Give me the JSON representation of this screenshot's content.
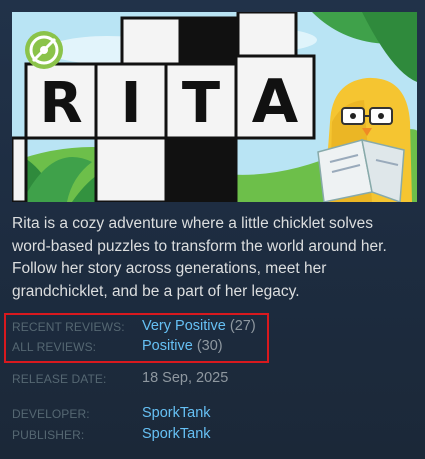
{
  "capsule": {
    "title_letters": [
      "R",
      "I",
      "T",
      "A"
    ]
  },
  "description": "Rita is a cozy adventure where a little chicklet solves word-based puzzles to transform the world around her. Follow her story across generations, meet her grandchicklet, and be a part of her legacy.",
  "reviews": {
    "recent": {
      "label": "RECENT REVIEWS:",
      "summary": "Very Positive",
      "count": "(27)"
    },
    "all": {
      "label": "ALL REVIEWS:",
      "summary": "Positive",
      "count": "(30)"
    }
  },
  "release": {
    "label": "RELEASE DATE:",
    "date": "18 Sep, 2025"
  },
  "developer": {
    "label": "DEVELOPER:",
    "name": "SporkTank"
  },
  "publisher": {
    "label": "PUBLISHER:",
    "name": "SporkTank"
  },
  "colors": {
    "background": "#1b2838",
    "link": "#66c0f4",
    "label": "#556772",
    "text": "#dcdedf",
    "muted": "#8f98a0",
    "highlight": "#d8191e"
  }
}
